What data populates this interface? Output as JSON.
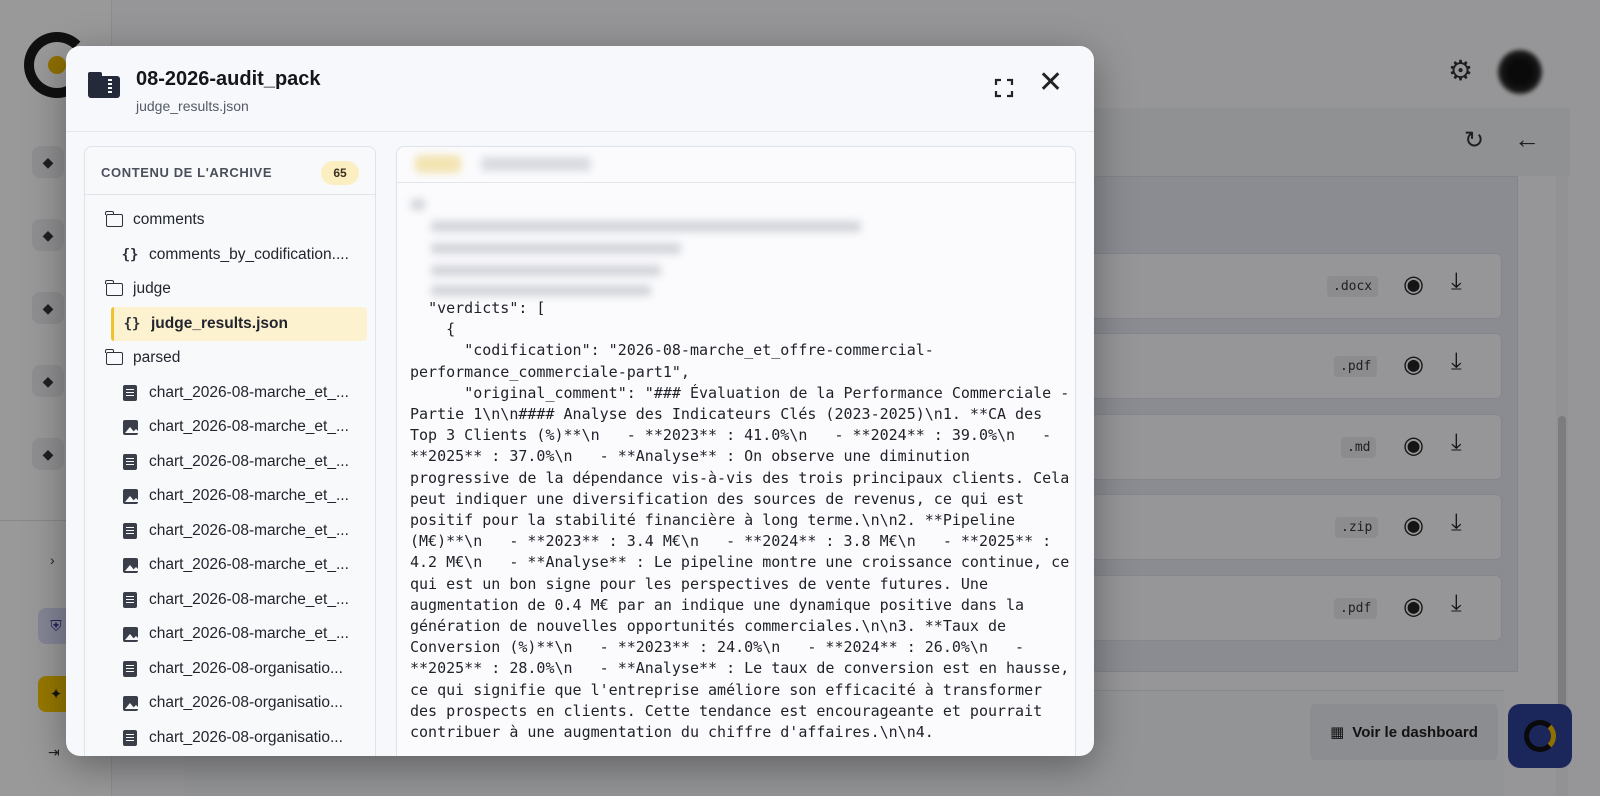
{
  "background": {
    "dashboard_button_label": "Voir le dashboard",
    "file_rows": [
      {
        "ext": ".docx"
      },
      {
        "ext": ".pdf"
      },
      {
        "ext": ".md"
      },
      {
        "ext": ".zip"
      },
      {
        "ext": ".pdf"
      }
    ]
  },
  "modal": {
    "title": "08-2026-audit_pack",
    "subtitle": "judge_results.json"
  },
  "tree": {
    "title": "CONTENU DE L'ARCHIVE",
    "count": "65",
    "items": [
      {
        "kind": "folder",
        "label": "comments"
      },
      {
        "kind": "json",
        "label": "comments_by_codification...."
      },
      {
        "kind": "folder",
        "label": "judge"
      },
      {
        "kind": "json",
        "label": "judge_results.json",
        "selected": true
      },
      {
        "kind": "folder",
        "label": "parsed"
      },
      {
        "kind": "doc",
        "label": "chart_2026-08-marche_et_..."
      },
      {
        "kind": "img",
        "label": "chart_2026-08-marche_et_..."
      },
      {
        "kind": "doc",
        "label": "chart_2026-08-marche_et_..."
      },
      {
        "kind": "img",
        "label": "chart_2026-08-marche_et_..."
      },
      {
        "kind": "doc",
        "label": "chart_2026-08-marche_et_..."
      },
      {
        "kind": "img",
        "label": "chart_2026-08-marche_et_..."
      },
      {
        "kind": "doc",
        "label": "chart_2026-08-marche_et_..."
      },
      {
        "kind": "img",
        "label": "chart_2026-08-marche_et_..."
      },
      {
        "kind": "doc",
        "label": "chart_2026-08-organisatio..."
      },
      {
        "kind": "img",
        "label": "chart_2026-08-organisatio..."
      },
      {
        "kind": "doc",
        "label": "chart_2026-08-organisatio..."
      }
    ]
  },
  "viewer": {
    "code": "  \"verdicts\": [\n    {\n      \"codification\": \"2026-08-marche_et_offre-commercial-performance_commerciale-part1\",\n      \"original_comment\": \"### Évaluation de la Performance Commerciale - Partie 1\\n\\n#### Analyse des Indicateurs Clés (2023-2025)\\n1. **CA des Top 3 Clients (%)**\\n   - **2023** : 41.0%\\n   - **2024** : 39.0%\\n   - **2025** : 37.0%\\n   - **Analyse** : On observe une diminution progressive de la dépendance vis-à-vis des trois principaux clients. Cela peut indiquer une diversification des sources de revenus, ce qui est positif pour la stabilité financière à long terme.\\n\\n2. **Pipeline (M€)**\\n   - **2023** : 3.4 M€\\n   - **2024** : 3.8 M€\\n   - **2025** : 4.2 M€\\n   - **Analyse** : Le pipeline montre une croissance continue, ce qui est un bon signe pour les perspectives de vente futures. Une augmentation de 0.4 M€ par an indique une dynamique positive dans la génération de nouvelles opportunités commerciales.\\n\\n3. **Taux de Conversion (%)**\\n   - **2023** : 24.0%\\n   - **2024** : 26.0%\\n   - **2025** : 28.0%\\n   - **Analyse** : Le taux de conversion est en hausse, ce qui signifie que l'entreprise améliore son efficacité à transformer des prospects en clients. Cette tendance est encourageante et pourrait contribuer à une augmentation du chiffre d'affaires.\\n\\n4."
  },
  "icons": {
    "archive": "archive-folder-icon",
    "expand": "expand-icon",
    "close": "close-icon",
    "folder": "folder-icon",
    "json": "json-file-icon",
    "doc": "document-icon",
    "img": "image-icon"
  },
  "colors": {
    "accent_yellow": "#f0c22c",
    "selected_bg": "#fdf2cf",
    "fab_blue": "#2c3f93"
  }
}
